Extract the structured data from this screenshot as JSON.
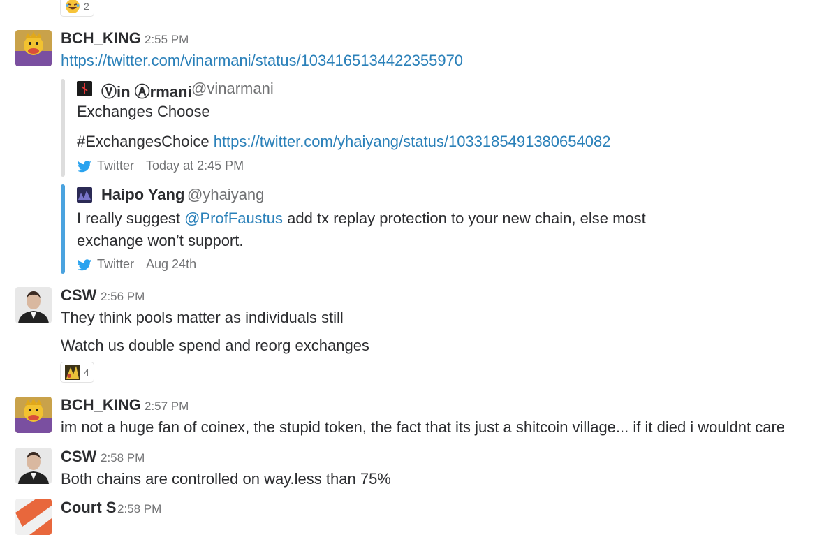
{
  "top_reaction": {
    "count": "2"
  },
  "messages": [
    {
      "author": "BCH_KING",
      "time": "2:55 PM",
      "link": "https://twitter.com/vinarmani/status/1034165134422355970",
      "quote1": {
        "author": "Ⓥin Ⓐrmani",
        "handle": "@vinarmani",
        "line1": "Exchanges Choose",
        "line2_text": "#ExchangesChoice",
        "line2_link": "https://twitter.com/yhaiyang/status/1033185491380654082",
        "footer_source": "Twitter",
        "footer_time": "Today at 2:45 PM"
      },
      "quote2": {
        "author": "Haipo Yang",
        "handle": "@yhaiyang",
        "line1_pre": "I really suggest",
        "line1_mention": "@ProfFaustus",
        "line1_post": "add tx replay protection to your new chain, else most",
        "line2": "exchange won’t support.",
        "footer_source": "Twitter",
        "footer_time": "Aug 24th"
      }
    },
    {
      "author": "CSW",
      "time": "2:56 PM",
      "line1": "They think pools matter as individuals still",
      "line2": "Watch us double spend and reorg exchanges",
      "reaction_count": "4"
    },
    {
      "author": "BCH_KING",
      "time": "2:57 PM",
      "line1": "im not a huge fan of coinex, the stupid token, the fact that its just a shitcoin village... if it died i wouldnt care"
    },
    {
      "author": "CSW",
      "time": "2:58 PM",
      "line1": "Both chains are controlled on way.less than 75%"
    },
    {
      "author": "Court S",
      "time": "2:58 PM"
    }
  ],
  "colors": {
    "link": "#2a80b9",
    "quote_bar_gray": "#dddddd",
    "quote_bar_blue": "#4aa3df",
    "muted_text": "#717274"
  }
}
